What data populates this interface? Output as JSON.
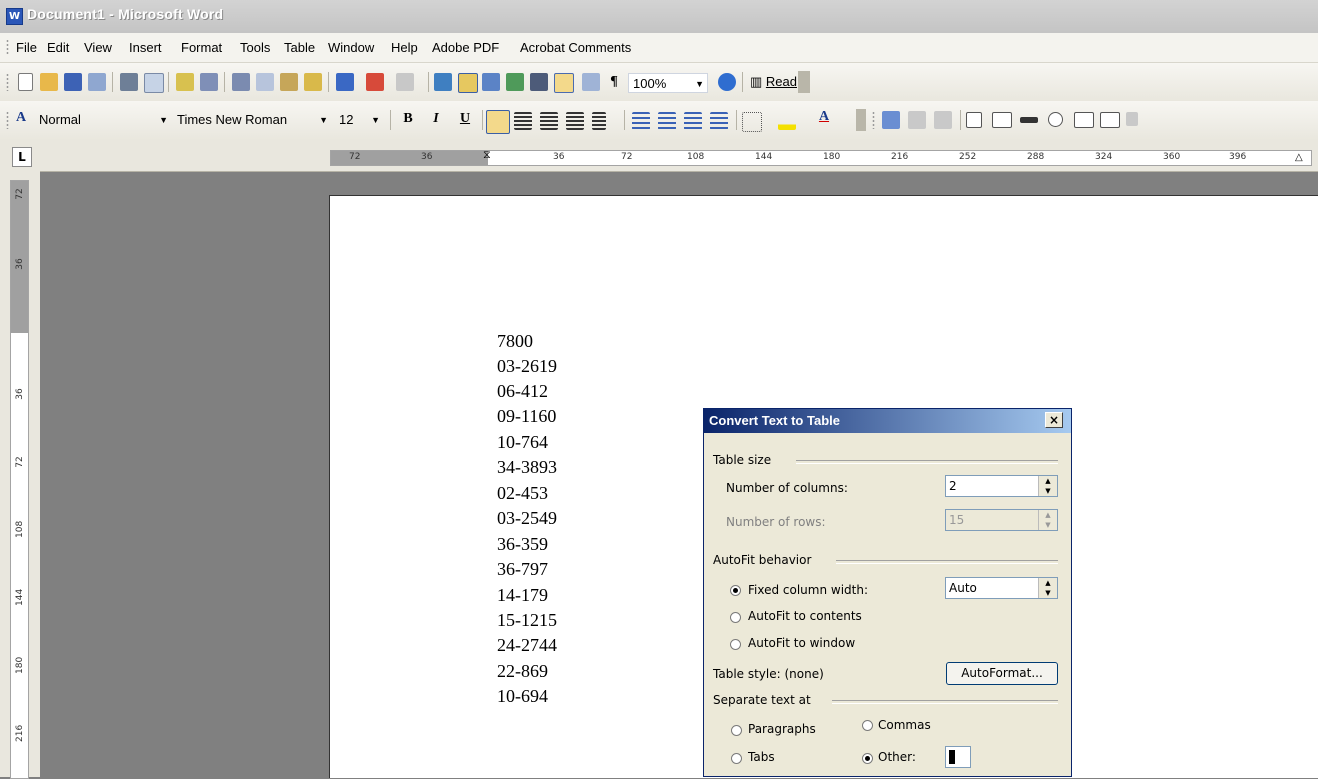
{
  "window": {
    "title": "Document1 - Microsoft Word"
  },
  "menu": [
    "File",
    "Edit",
    "View",
    "Insert",
    "Format",
    "Tools",
    "Table",
    "Window",
    "Help",
    "Adobe PDF",
    "Acrobat Comments"
  ],
  "standard_toolbar": {
    "zoom": "100%",
    "read_label": "Read"
  },
  "formatting_toolbar": {
    "style": "Normal",
    "font": "Times New Roman",
    "size": "12",
    "bold": "B",
    "italic": "I",
    "underline": "U"
  },
  "ruler": {
    "tab_selector": "L",
    "h_labels": [
      "72",
      "36",
      "36",
      "72",
      "108",
      "144",
      "180",
      "216",
      "252",
      "288",
      "324",
      "360",
      "396"
    ],
    "v_labels": [
      "72",
      "36",
      "36",
      "72",
      "108",
      "144",
      "180",
      "216"
    ]
  },
  "document": {
    "lines": [
      "7800",
      "03-2619",
      "06-412",
      "09-1160",
      "10-764",
      "34-3893",
      "02-453",
      "03-2549",
      "36-359",
      "36-797",
      "14-179",
      "15-1215",
      "24-2744",
      "22-869",
      "10-694"
    ]
  },
  "dialog": {
    "title": "Convert Text to Table",
    "close_glyph": "×",
    "table_size": {
      "group": "Table size",
      "columns_label": "Number of columns:",
      "columns_value": "2",
      "rows_label": "Number of rows:",
      "rows_value": "15"
    },
    "autofit": {
      "group": "AutoFit behavior",
      "fixed_label": "Fixed column width:",
      "fixed_value": "Auto",
      "contents_label": "AutoFit to contents",
      "window_label": "AutoFit to window",
      "selected": "fixed"
    },
    "table_style": {
      "label": "Table style:  (none)",
      "button": "AutoFormat..."
    },
    "separate": {
      "group": "Separate text at",
      "paragraphs": "Paragraphs",
      "commas": "Commas",
      "tabs": "Tabs",
      "other": "Other:",
      "selected": "other"
    }
  },
  "colors": {
    "titlebar_accent": "#0a246a",
    "desktop": "#808080"
  }
}
